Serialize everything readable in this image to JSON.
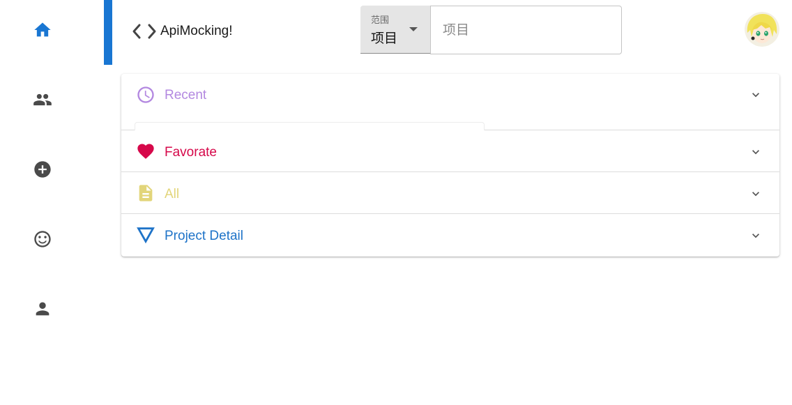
{
  "header": {
    "app_title": "ApiMocking!",
    "scope_label": "范围",
    "scope_value": "项目",
    "search_placeholder": "项目"
  },
  "sidebar": {
    "items": [
      {
        "name": "home",
        "icon": "home-icon",
        "active": true
      },
      {
        "name": "people",
        "icon": "people-icon"
      },
      {
        "name": "add",
        "icon": "add-circle-icon"
      },
      {
        "name": "emoji",
        "icon": "smiley-icon"
      },
      {
        "name": "person",
        "icon": "person-icon"
      }
    ]
  },
  "accordion": {
    "panels": [
      {
        "title": "Recent",
        "icon": "clock-icon",
        "color": "#b388e0"
      },
      {
        "title": "Favorate",
        "icon": "heart-icon",
        "color": "#d6084a"
      },
      {
        "title": "All",
        "icon": "file-icon",
        "color": "#e2d57a"
      },
      {
        "title": "Project Detail",
        "icon": "triangle-icon",
        "color": "#1e73c8"
      }
    ]
  },
  "colors": {
    "accent": "#1976d2",
    "nav_active": "#1976d2",
    "nav_inactive": "#4a4a4a"
  }
}
